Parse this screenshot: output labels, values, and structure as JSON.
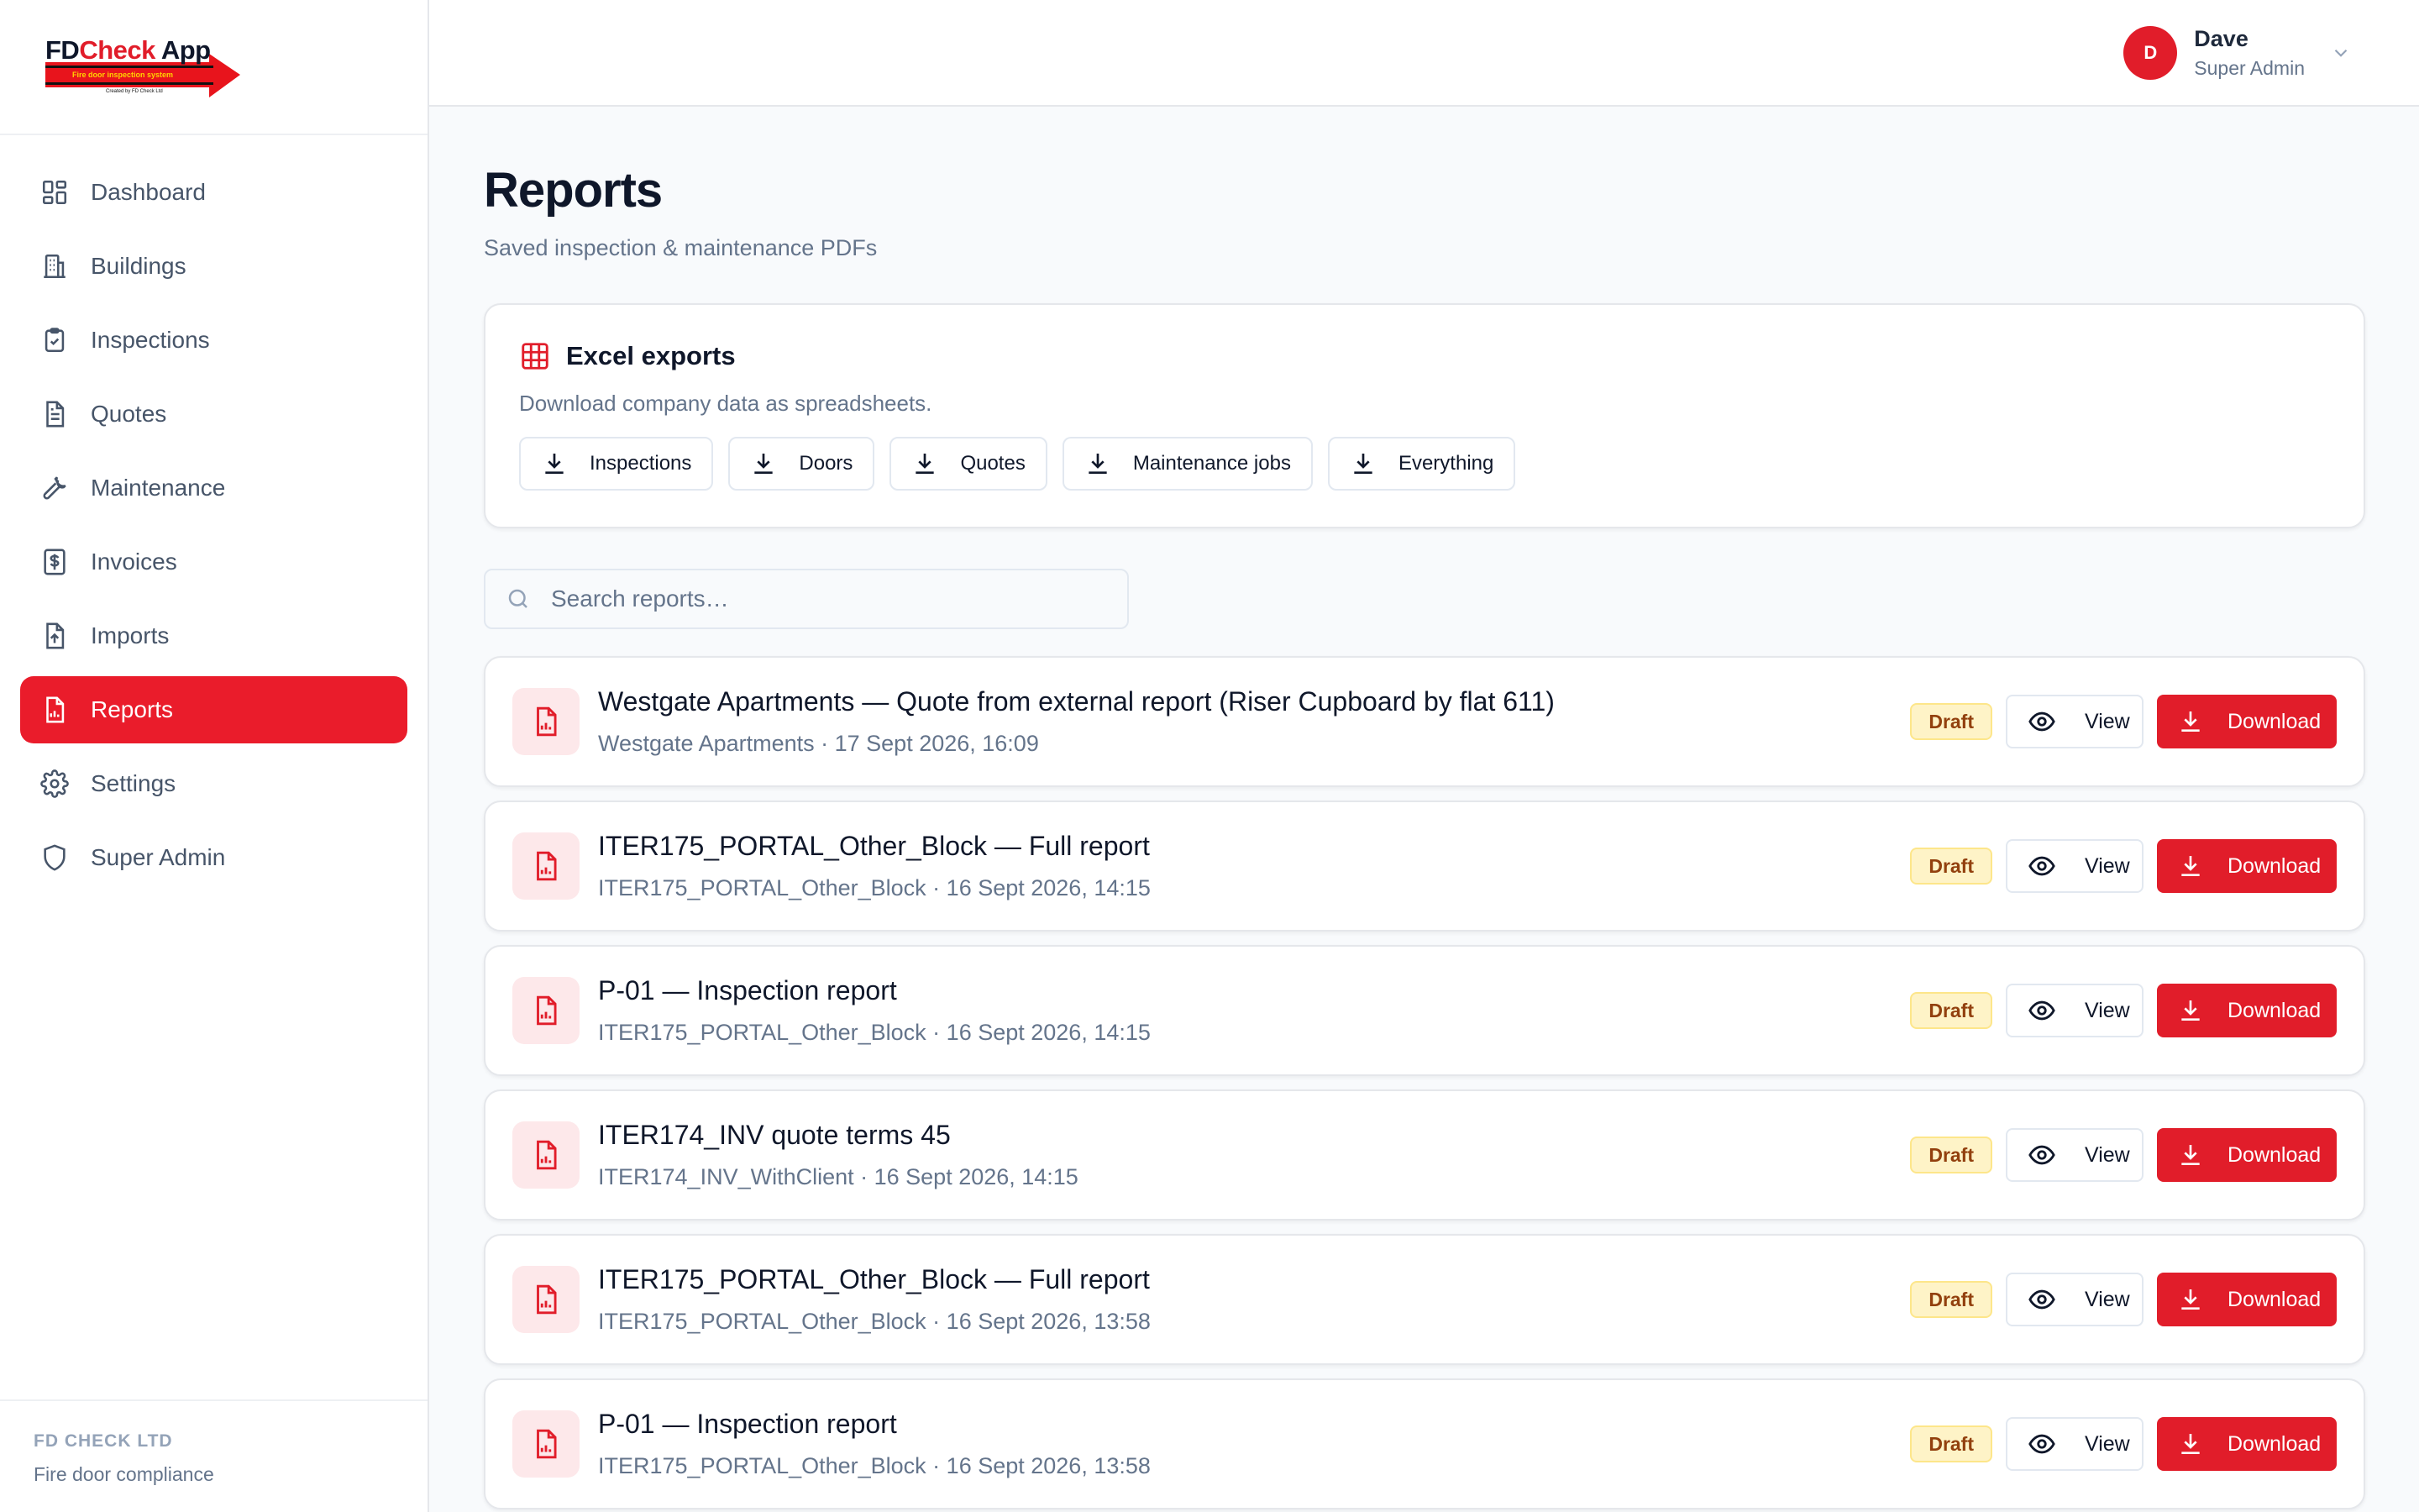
{
  "brand": {
    "logo_fd": "FD",
    "logo_check": "Check",
    "logo_app": "App",
    "logo_tagline": "Fire door inspection system",
    "logo_credit": "Created by FD Check Ltd",
    "accent": "#e11d2a"
  },
  "sidebar": {
    "items": [
      {
        "label": "Dashboard",
        "icon": "dashboard-icon"
      },
      {
        "label": "Buildings",
        "icon": "building-icon"
      },
      {
        "label": "Inspections",
        "icon": "clipboard-check-icon"
      },
      {
        "label": "Quotes",
        "icon": "file-text-icon"
      },
      {
        "label": "Maintenance",
        "icon": "wrench-icon"
      },
      {
        "label": "Invoices",
        "icon": "dollar-receipt-icon"
      },
      {
        "label": "Imports",
        "icon": "file-upload-icon"
      },
      {
        "label": "Reports",
        "icon": "file-chart-icon",
        "active": true
      },
      {
        "label": "Settings",
        "icon": "gear-icon"
      },
      {
        "label": "Super Admin",
        "icon": "shield-icon"
      }
    ],
    "footer": {
      "company": "FD CHECK LTD",
      "tagline": "Fire door compliance"
    }
  },
  "user": {
    "initial": "D",
    "name": "Dave",
    "role": "Super Admin"
  },
  "page": {
    "title": "Reports",
    "subtitle": "Saved inspection & maintenance PDFs"
  },
  "excel": {
    "title": "Excel exports",
    "subtitle": "Download company data as spreadsheets.",
    "buttons": [
      "Inspections",
      "Doors",
      "Quotes",
      "Maintenance jobs",
      "Everything"
    ]
  },
  "search": {
    "placeholder": "Search reports…"
  },
  "reports": [
    {
      "title": "Westgate Apartments — Quote from external report (Riser Cupboard by flat 611)",
      "meta": "Westgate Apartments · 17 Sept 2026, 16:09",
      "status": "Draft"
    },
    {
      "title": "ITER175_PORTAL_Other_Block — Full report",
      "meta": "ITER175_PORTAL_Other_Block · 16 Sept 2026, 14:15",
      "status": "Draft"
    },
    {
      "title": "P-01 — Inspection report",
      "meta": "ITER175_PORTAL_Other_Block · 16 Sept 2026, 14:15",
      "status": "Draft"
    },
    {
      "title": "ITER174_INV quote terms 45",
      "meta": "ITER174_INV_WithClient · 16 Sept 2026, 14:15",
      "status": "Draft"
    },
    {
      "title": "ITER175_PORTAL_Other_Block — Full report",
      "meta": "ITER175_PORTAL_Other_Block · 16 Sept 2026, 13:58",
      "status": "Draft"
    },
    {
      "title": "P-01 — Inspection report",
      "meta": "ITER175_PORTAL_Other_Block · 16 Sept 2026, 13:58",
      "status": "Draft"
    }
  ],
  "actions": {
    "view": "View",
    "download": "Download"
  }
}
